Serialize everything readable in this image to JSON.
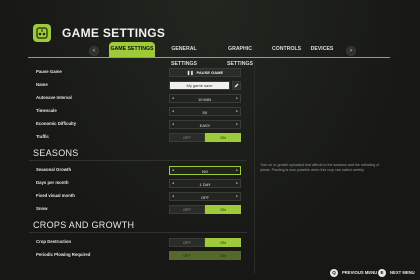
{
  "header": {
    "title": "GAME SETTINGS"
  },
  "tabs": [
    {
      "label": "GAME SETTINGS",
      "active": true
    },
    {
      "label": "GENERAL SETTINGS",
      "active": false
    },
    {
      "label": "GRAPHIC SETTINGS",
      "active": false
    },
    {
      "label": "CONTROLS",
      "active": false
    },
    {
      "label": "DEVICES",
      "active": false
    }
  ],
  "rows": {
    "pause": {
      "label": "Pause Game",
      "button": "PAUSE GAME",
      "icon": "pause-icon"
    },
    "name": {
      "label": "Name",
      "value": "My game save",
      "icon": "pencil-icon"
    },
    "autosave": {
      "label": "Autosave Interval",
      "value": "10 MIN."
    },
    "timescale": {
      "label": "Timescale",
      "value": "5X"
    },
    "difficulty": {
      "label": "Economic Difficulty",
      "value": "EASY"
    },
    "traffic": {
      "label": "Traffic",
      "off": "OFF",
      "on": "ON"
    }
  },
  "seasons": {
    "title": "SEASONS",
    "growth": {
      "label": "Seasonal Growth",
      "value": "NO"
    },
    "days": {
      "label": "Days per month",
      "value": "1 DAY"
    },
    "fixed": {
      "label": "Fixed visual month",
      "value": "OFF"
    },
    "snow": {
      "label": "Snow",
      "off": "OFF",
      "on": "ON"
    }
  },
  "crops": {
    "title": "CROPS AND GROWTH",
    "destruction": {
      "label": "Crop Destruction",
      "off": "OFF",
      "on": "ON"
    },
    "plowing": {
      "label": "Periodic Plowing Required",
      "off": "OFF",
      "on": "ON"
    }
  },
  "description": "Turn on or growth uploaded that affects to the seasons and the reflowing of plants. Planting is now possible when this crop can switch weekly.",
  "nav": {
    "prev": "<",
    "next": ">"
  },
  "footer": {
    "prev_key": "Q",
    "prev_label": "PREVIOUS MENU",
    "next_key": "E",
    "next_label": "NEXT MENU"
  },
  "colors": {
    "accent": "#9ecb3a",
    "background": "#181a17"
  }
}
